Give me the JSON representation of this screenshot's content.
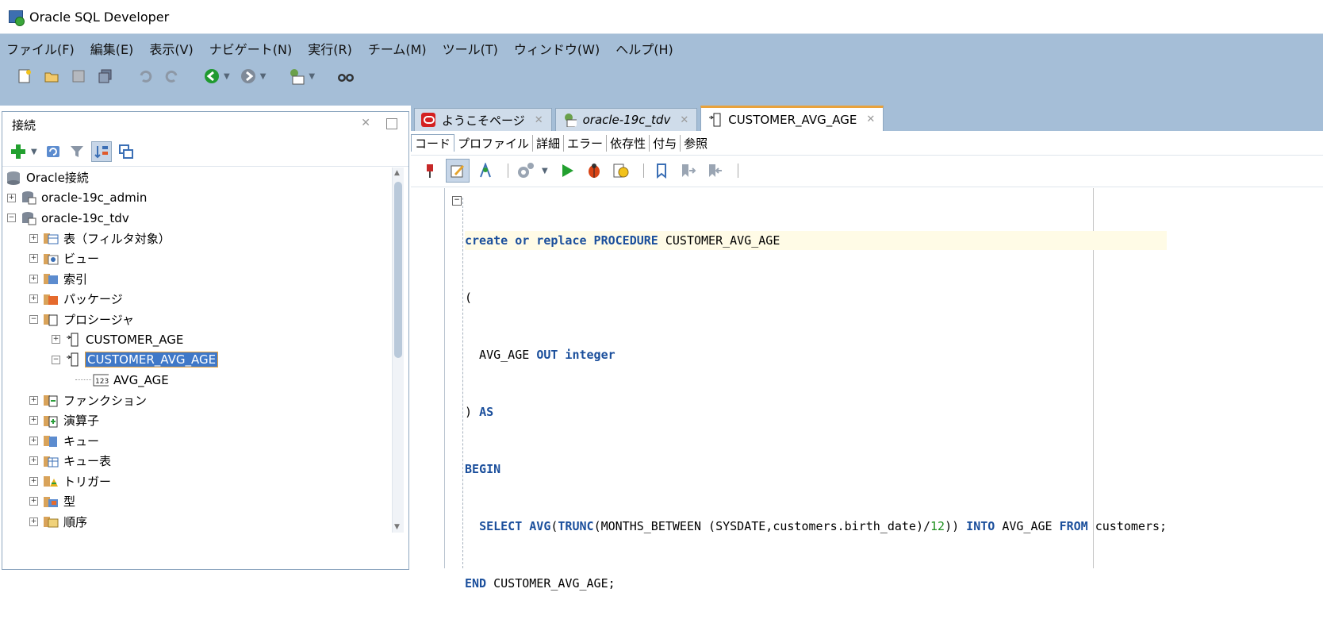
{
  "window": {
    "title": "Oracle SQL Developer"
  },
  "menu": [
    "ファイル(F)",
    "編集(E)",
    "表示(V)",
    "ナビゲート(N)",
    "実行(R)",
    "チーム(M)",
    "ツール(T)",
    "ウィンドウ(W)",
    "ヘルプ(H)"
  ],
  "connections_panel": {
    "title": "接続",
    "tree": [
      {
        "label": "Oracle接続",
        "level": 0,
        "icon": "database-icon",
        "expander": ""
      },
      {
        "label": "oracle-19c_admin",
        "level": 1,
        "icon": "connection-icon",
        "expander": "+"
      },
      {
        "label": "oracle-19c_tdv",
        "level": 1,
        "icon": "connection-icon",
        "expander": "−"
      },
      {
        "label": "表（フィルタ対象）",
        "level": 2,
        "icon": "tables-icon",
        "expander": "+"
      },
      {
        "label": "ビュー",
        "level": 2,
        "icon": "views-icon",
        "expander": "+"
      },
      {
        "label": "索引",
        "level": 2,
        "icon": "index-icon",
        "expander": "+"
      },
      {
        "label": "パッケージ",
        "level": 2,
        "icon": "package-icon",
        "expander": "+"
      },
      {
        "label": "プロシージャ",
        "level": 2,
        "icon": "procedures-icon",
        "expander": "−"
      },
      {
        "label": "CUSTOMER_AGE",
        "level": 3,
        "icon": "procedure-icon",
        "expander": "+"
      },
      {
        "label": "CUSTOMER_AVG_AGE",
        "level": 3,
        "icon": "procedure-icon",
        "expander": "−",
        "selected": true
      },
      {
        "label": "AVG_AGE",
        "level": 4,
        "icon": "parameter-icon",
        "expander": ""
      },
      {
        "label": "ファンクション",
        "level": 2,
        "icon": "functions-icon",
        "expander": "+"
      },
      {
        "label": "演算子",
        "level": 2,
        "icon": "operators-icon",
        "expander": "+"
      },
      {
        "label": "キュー",
        "level": 2,
        "icon": "queues-icon",
        "expander": "+"
      },
      {
        "label": "キュー表",
        "level": 2,
        "icon": "queue-tables-icon",
        "expander": "+"
      },
      {
        "label": "トリガー",
        "level": 2,
        "icon": "triggers-icon",
        "expander": "+"
      },
      {
        "label": "型",
        "level": 2,
        "icon": "types-icon",
        "expander": "+"
      },
      {
        "label": "順序",
        "level": 2,
        "icon": "sequences-icon",
        "expander": "+"
      }
    ]
  },
  "editor_tabs": [
    {
      "label": "ようこそページ",
      "icon": "oracle-icon"
    },
    {
      "label": "oracle-19c_tdv",
      "icon": "sql-worksheet-icon"
    },
    {
      "label": "CUSTOMER_AVG_AGE",
      "icon": "procedure-icon",
      "active": true
    }
  ],
  "sub_tabs": [
    "コード",
    "プロファイル",
    "詳細",
    "エラー",
    "依存性",
    "付与",
    "参照"
  ],
  "code": [
    "create or replace PROCEDURE CUSTOMER_AVG_AGE",
    "(",
    "  AVG_AGE OUT integer",
    ") AS",
    "BEGIN",
    "  SELECT AVG(TRUNC(MONTHS_BETWEEN (SYSDATE,customers.birth_date)/12)) INTO AVG_AGE FROM customers;",
    "END CUSTOMER_AVG_AGE;"
  ],
  "colors": {
    "chrome": "#a5bed7",
    "keyword": "#1b4f9c",
    "selection": "#3f78c8",
    "active_tab_accent": "#e9a23b"
  }
}
